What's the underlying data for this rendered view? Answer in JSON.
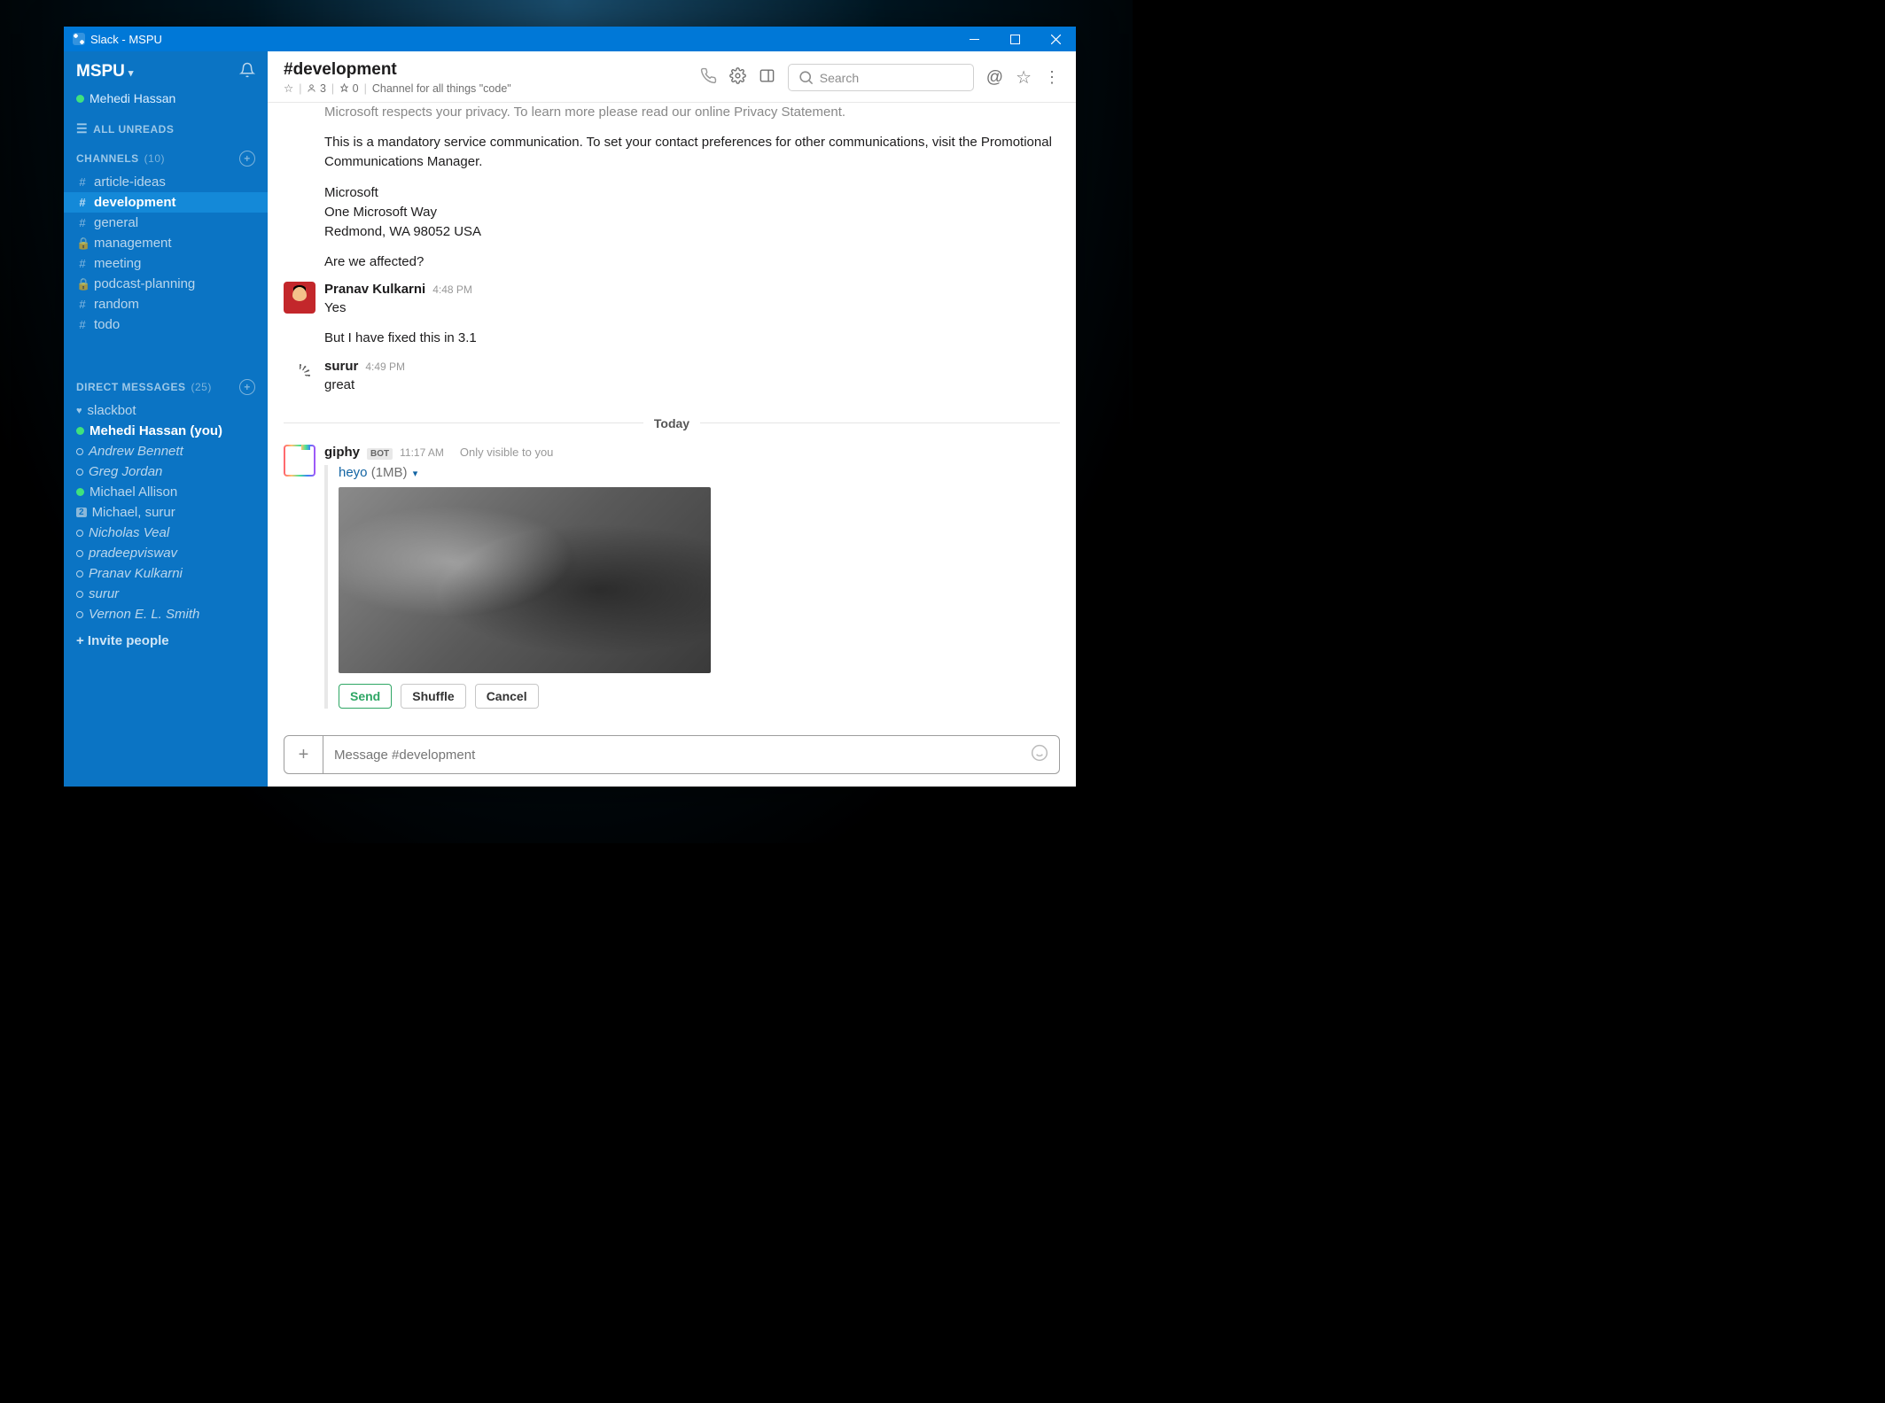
{
  "window": {
    "title": "Slack - MSPU"
  },
  "workspace": {
    "name": "MSPU",
    "user": "Mehedi Hassan"
  },
  "sidebar": {
    "allUnreads": "ALL UNREADS",
    "channelsHeader": "CHANNELS",
    "channelsCount": "(10)",
    "channels": [
      {
        "prefix": "#",
        "name": "article-ideas"
      },
      {
        "prefix": "#",
        "name": "development",
        "active": true
      },
      {
        "prefix": "#",
        "name": "general"
      },
      {
        "prefix": "lock",
        "name": "management"
      },
      {
        "prefix": "#",
        "name": "meeting"
      },
      {
        "prefix": "lock",
        "name": "podcast-planning"
      },
      {
        "prefix": "#",
        "name": "random"
      },
      {
        "prefix": "#",
        "name": "todo"
      }
    ],
    "dmHeader": "DIRECT MESSAGES",
    "dmCount": "(25)",
    "dms": [
      {
        "presence": "heart",
        "name": "slackbot"
      },
      {
        "presence": "active",
        "name": "Mehedi Hassan (you)"
      },
      {
        "presence": "away",
        "name": "Andrew Bennett",
        "italic": true
      },
      {
        "presence": "away",
        "name": "Greg Jordan",
        "italic": true
      },
      {
        "presence": "active",
        "name": "Michael Allison"
      },
      {
        "presence": "badge",
        "name": "Michael, surur",
        "badge": "2"
      },
      {
        "presence": "away",
        "name": "Nicholas Veal",
        "italic": true
      },
      {
        "presence": "away",
        "name": "pradeepviswav",
        "italic": true
      },
      {
        "presence": "away",
        "name": "Pranav Kulkarni",
        "italic": true
      },
      {
        "presence": "away",
        "name": "surur",
        "italic": true
      },
      {
        "presence": "away",
        "name": "Vernon E. L. Smith",
        "italic": true
      }
    ],
    "invite": "+ Invite people"
  },
  "channelHeader": {
    "name": "#development",
    "members": "3",
    "pins": "0",
    "topic": "Channel for all things \"code\"",
    "searchPlaceholder": "Search"
  },
  "divider": {
    "label": "Today"
  },
  "messages": {
    "pretext": [
      "Microsoft respects your privacy. To learn more please read our online Privacy Statement.",
      "This is a mandatory service communication. To set your contact preferences for other communications, visit the Promotional Communications Manager.",
      "Microsoft",
      "One Microsoft Way",
      "Redmond, WA 98052 USA",
      "Are we affected?"
    ],
    "m1": {
      "author": "Pranav Kulkarni",
      "time": "4:48 PM",
      "l1": "Yes",
      "l2": "But I have fixed this in 3.1"
    },
    "m2": {
      "author": "surur",
      "time": "4:49 PM",
      "l1": "great"
    },
    "m3": {
      "author": "giphy",
      "bot": "BOT",
      "time": "11:17 AM",
      "visibility": "Only visible to you",
      "attachName": "heyo",
      "attachSize": "(1MB)",
      "btnSend": "Send",
      "btnShuffle": "Shuffle",
      "btnCancel": "Cancel"
    }
  },
  "composer": {
    "placeholder": "Message #development"
  }
}
